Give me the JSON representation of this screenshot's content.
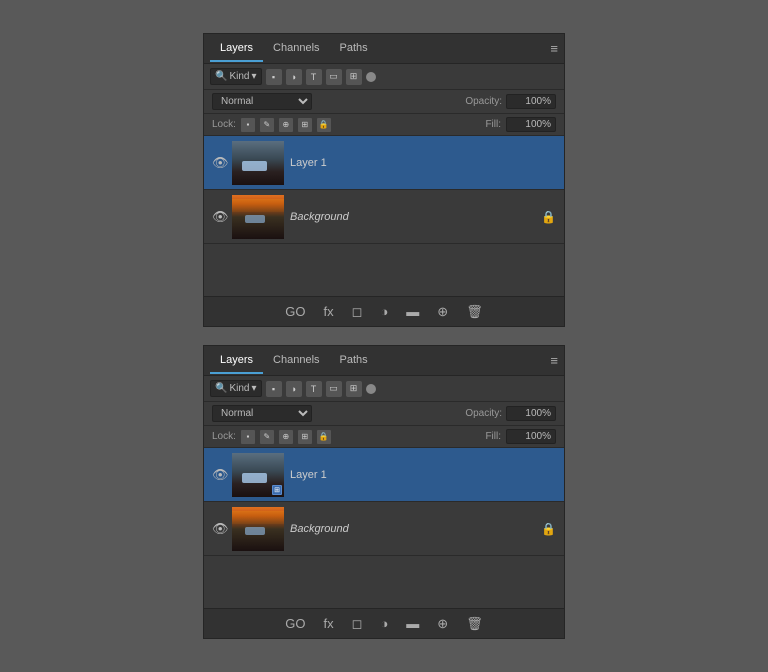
{
  "panels": [
    {
      "id": "panel1",
      "tabs": [
        "Layers",
        "Channels",
        "Paths"
      ],
      "activeTab": "Layers",
      "filter": {
        "searchLabel": "🔍",
        "kindLabel": "Kind",
        "dropdownArrow": "▾"
      },
      "blendMode": "Normal",
      "opacity": "100%",
      "fill": "100%",
      "layers": [
        {
          "name": "Layer 1",
          "italic": false,
          "locked": false,
          "smartObject": false,
          "selected": true
        },
        {
          "name": "Background",
          "italic": true,
          "locked": true,
          "smartObject": false,
          "selected": false
        }
      ],
      "bottomIcons": [
        "GO",
        "fx",
        "◻",
        "◑",
        "▬",
        "⊕",
        "🗑"
      ]
    },
    {
      "id": "panel2",
      "tabs": [
        "Layers",
        "Channels",
        "Paths"
      ],
      "activeTab": "Layers",
      "filter": {
        "searchLabel": "🔍",
        "kindLabel": "Kind",
        "dropdownArrow": "▾"
      },
      "blendMode": "Normal",
      "opacity": "100%",
      "fill": "100%",
      "layers": [
        {
          "name": "Layer 1",
          "italic": false,
          "locked": false,
          "smartObject": true,
          "selected": true
        },
        {
          "name": "Background",
          "italic": true,
          "locked": true,
          "smartObject": false,
          "selected": false
        }
      ],
      "bottomIcons": [
        "GO",
        "fx",
        "◻",
        "◑",
        "▬",
        "⊕",
        "🗑"
      ]
    }
  ],
  "labels": {
    "lock": "Lock:",
    "opacity": "Opacity:",
    "fill": "Fill:",
    "normal": "Normal",
    "opacity_val": "100%",
    "fill_val": "100%",
    "go": "GO",
    "fx": "fx"
  }
}
